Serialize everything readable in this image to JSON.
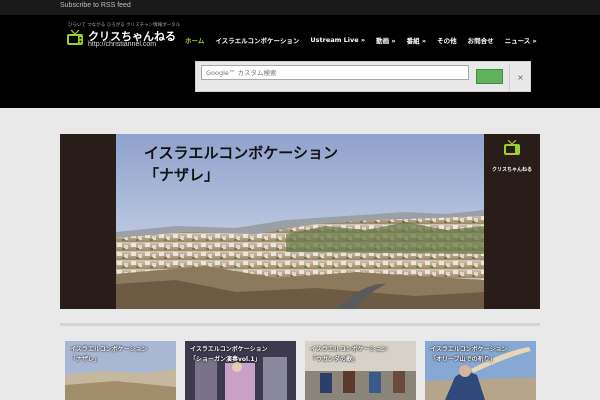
{
  "topbar": {
    "rss_label": "Subscribe to RSS feed"
  },
  "logo": {
    "tagline": "ひらいて つながる ひろがる クリスチャン情報ポータル",
    "name": "クリスちゃんねる",
    "url": "http://christiannel.com"
  },
  "nav": {
    "items": [
      {
        "label": "ホーム",
        "active": true
      },
      {
        "label": "イスラエルコンボケーション"
      },
      {
        "label": "Ustream Live »"
      },
      {
        "label": "動画 »"
      },
      {
        "label": "番組 »"
      },
      {
        "label": "その他"
      },
      {
        "label": "お問合せ"
      },
      {
        "label": "ニュース »"
      }
    ]
  },
  "search": {
    "placeholder": "Google™ カスタム検索",
    "close_label": "×"
  },
  "hero": {
    "title": "イスラエルコンボケーション\n「ナザレ」",
    "brand_label": "クリスちゃんねる"
  },
  "thumbs": [
    {
      "caption": "イスラエルコンボケーション\n「ナザレ」"
    },
    {
      "caption": "イスラエルコンボケーション\n「ショーガン演奏vol.1」"
    },
    {
      "caption": "イスラエルコンボケーション\n「ウガンダの歌」"
    },
    {
      "caption": "イスラエルコンボケーション\n「オリーブ山での祈り」"
    }
  ],
  "colors": {
    "accent": "#9ad12a",
    "header_bg": "#000000",
    "search_button": "#5fb35f"
  }
}
